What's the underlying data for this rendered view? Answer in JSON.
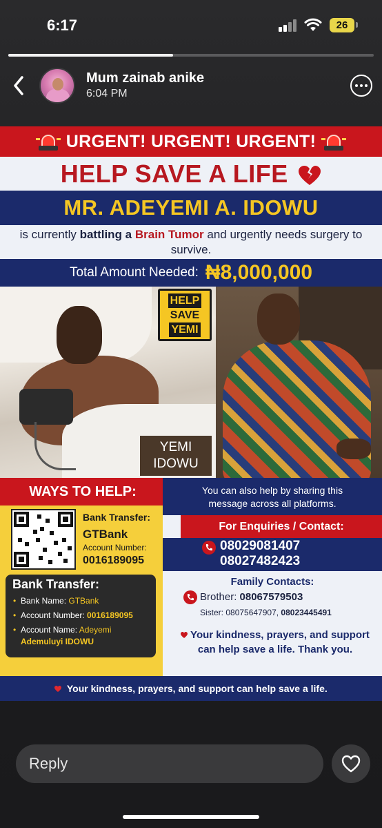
{
  "status_bar": {
    "time": "6:17",
    "battery": "26"
  },
  "story": {
    "progress_percent": 45
  },
  "header": {
    "name": "Mum zainab anike",
    "time": "6:04 PM"
  },
  "poster": {
    "urgent": "URGENT! URGENT! URGENT!",
    "title": "HELP SAVE A LIFE",
    "patient_name": "MR. ADEYEMI A. IDOWU",
    "desc_pre": "is currently ",
    "desc_bold": "battling a ",
    "desc_red": "Brain Tumor",
    "desc_post": " and urgently needs surgery to survive.",
    "amount_label": "Total Amount Needed:",
    "amount_value": "₦8,000,000",
    "tag_line1": "HELP",
    "tag_line2": "SAVE",
    "tag_line3": "YEMI",
    "name_tag_line1": "YEMI",
    "name_tag_line2": "IDOWU",
    "ways": "WAYS TO HELP:",
    "bank_transfer_label": "Bank Transfer:",
    "bank_name": "GTBank",
    "account_number_label": "Account Number:",
    "account_number": "0016189095",
    "box_title": "Bank Transfer:",
    "box_bank_label": "Bank Name: ",
    "box_bank_value": "GTBank",
    "box_acc_label": "Account Number: ",
    "box_acc_value": "0016189095",
    "box_accname_label": "Account Name: ",
    "box_accname_value1": "Adeyemi",
    "box_accname_value2": "Ademuluyi IDOWU",
    "share_line1": "You can also help by sharing this",
    "share_line2": "message across all platforms.",
    "enquiries": "For Enquiries / Contact:",
    "phone1": "08029081407",
    "phone2": "08027482423",
    "family_title": "Family Contacts:",
    "brother_label": "Brother: ",
    "brother_phone": "08067579503",
    "sister_label": "Sister: 08075647907, ",
    "sister_phone2": "08023445491",
    "kindness_line1": "Your kindness, prayers, and support",
    "kindness_line2": "can help save a life. Thank you.",
    "footer": "Your kindness, prayers, and support can help save a life."
  },
  "reply": {
    "placeholder": "Reply"
  },
  "colors": {
    "red": "#c9161d",
    "navy": "#1b2a6b",
    "gold": "#f5c623"
  }
}
